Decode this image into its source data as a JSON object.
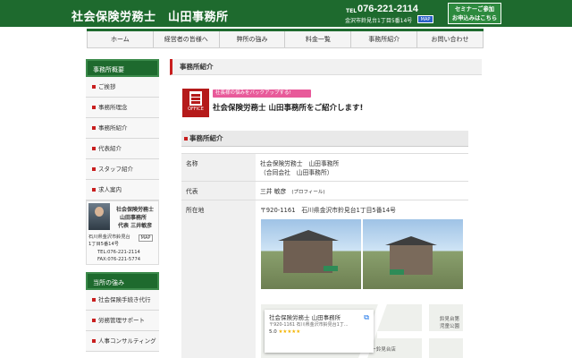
{
  "header": {
    "site_title": "社会保険労務士　山田事務所",
    "tel_label": "TEL",
    "tel_number": "076-221-2114",
    "address": "金沢市鈴見台1丁目5番14号",
    "map_button": "MAP",
    "cta_line1": "セミナーご参加",
    "cta_line2": "お申込みはこちら"
  },
  "nav": {
    "items": [
      "ホーム",
      "経営者の皆様へ",
      "弊所の強み",
      "料金一覧",
      "事務所紹介",
      "お問い合わせ"
    ]
  },
  "sidebar": {
    "head1": "事務所概要",
    "menu1": [
      "ご挨拶",
      "事務所理念",
      "事務所紹介",
      "代表紹介",
      "スタッフ紹介",
      "求人案内"
    ],
    "profile": {
      "line1": "社会保険労務士",
      "line2": "山田事務所",
      "line3": "代表 三井敏彦",
      "address1": "石川県金沢市鈴見台",
      "address2": "1丁目5番14号",
      "map_button": "MAP",
      "tel": "TEL:076-221-2114",
      "fax": "FAX:076-221-5774"
    },
    "head2": "当所の強み",
    "menu2": [
      "社会保険手続き代行",
      "労務管理サポート",
      "人事コンサルティング"
    ]
  },
  "main": {
    "title": "事務所紹介",
    "banner_tag": "社長様の悩みをバックアップする!",
    "banner_main": "社会保険労務士 山田事務所をご紹介します!",
    "office_icon_label": "OFFICE",
    "section_head": "事務所紹介",
    "table": {
      "name_label": "名称",
      "name_value1": "社会保険労務士　山田事務所",
      "name_value2": "（合同会社　山田事務所）",
      "rep_label": "代表",
      "rep_value": "三井 敏彦",
      "rep_note": "(プロフィール)",
      "location_label": "所在地",
      "location_value": "〒920-1161　石川県金沢市鈴見台1丁目5番14号"
    },
    "map": {
      "place_name": "社会保険労務士 山田事務所",
      "place_address": "〒920-1161 石川県金沢市鈴見台1丁...",
      "rating": "5.0",
      "stars": "★★★★★",
      "label_park": "鈴見台第\n児童公園",
      "label_kfc": "ケンキー鈴見台店"
    }
  }
}
